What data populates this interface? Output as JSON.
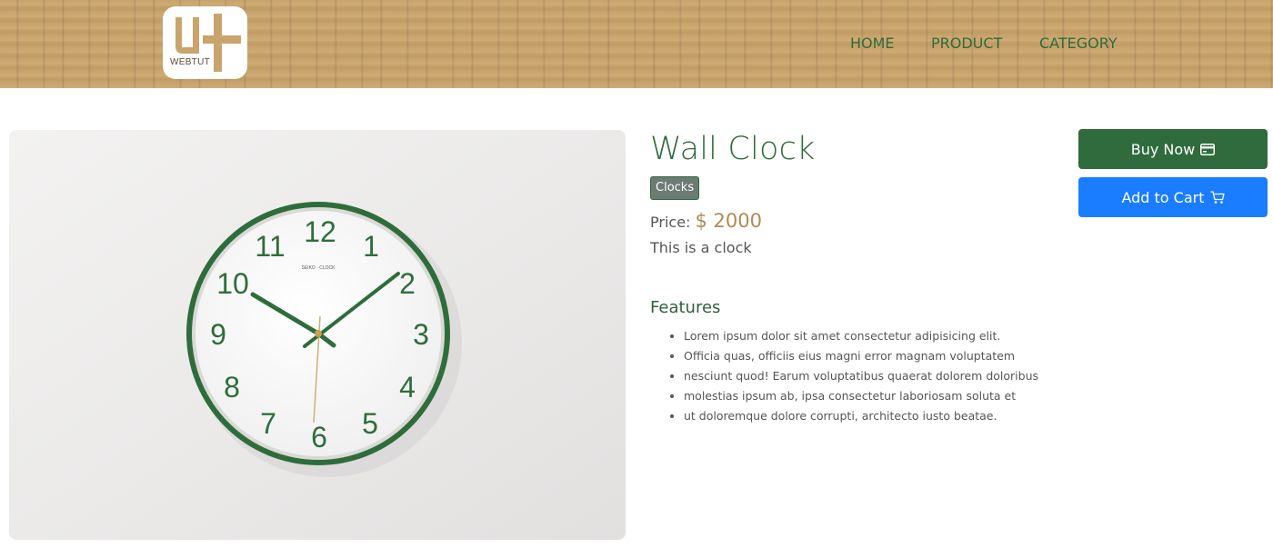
{
  "brand": {
    "logo_text": "WEBTUT"
  },
  "nav": {
    "items": [
      "HOME",
      "PRODUCT",
      "CATEGORY"
    ]
  },
  "product": {
    "title": "Wall Clock",
    "category_badge": "Clocks",
    "price_label": "Price:",
    "price_value": "$ 2000",
    "description": "This is a clock",
    "features_title": "Features",
    "features": [
      "Lorem ipsum dolor sit amet consectetur adipisicing elit.",
      "Officia quas, officiis eius magni error magnam voluptatem",
      "nesciunt quod! Earum voluptatibus quaerat dolorem doloribus",
      "molestias ipsum ab, ipsa consectetur laboriosam soluta et",
      "ut doloremque dolore corrupti, architecto iusto beatae."
    ],
    "image": {
      "clock_numbers": [
        "12",
        "1",
        "2",
        "3",
        "4",
        "5",
        "6",
        "7",
        "8",
        "9",
        "10",
        "11"
      ],
      "dial_brand": "SEIKO · CLOCK"
    }
  },
  "actions": {
    "buy_now_label": "Buy Now",
    "add_to_cart_label": "Add to Cart",
    "buy_icon": "credit-card-icon",
    "cart_icon": "cart-icon"
  },
  "colors": {
    "brand_green": "#2f6b3c",
    "cart_blue": "#1a7dff",
    "price_gold": "#b08a55",
    "header_wood": "#c9a46c"
  }
}
